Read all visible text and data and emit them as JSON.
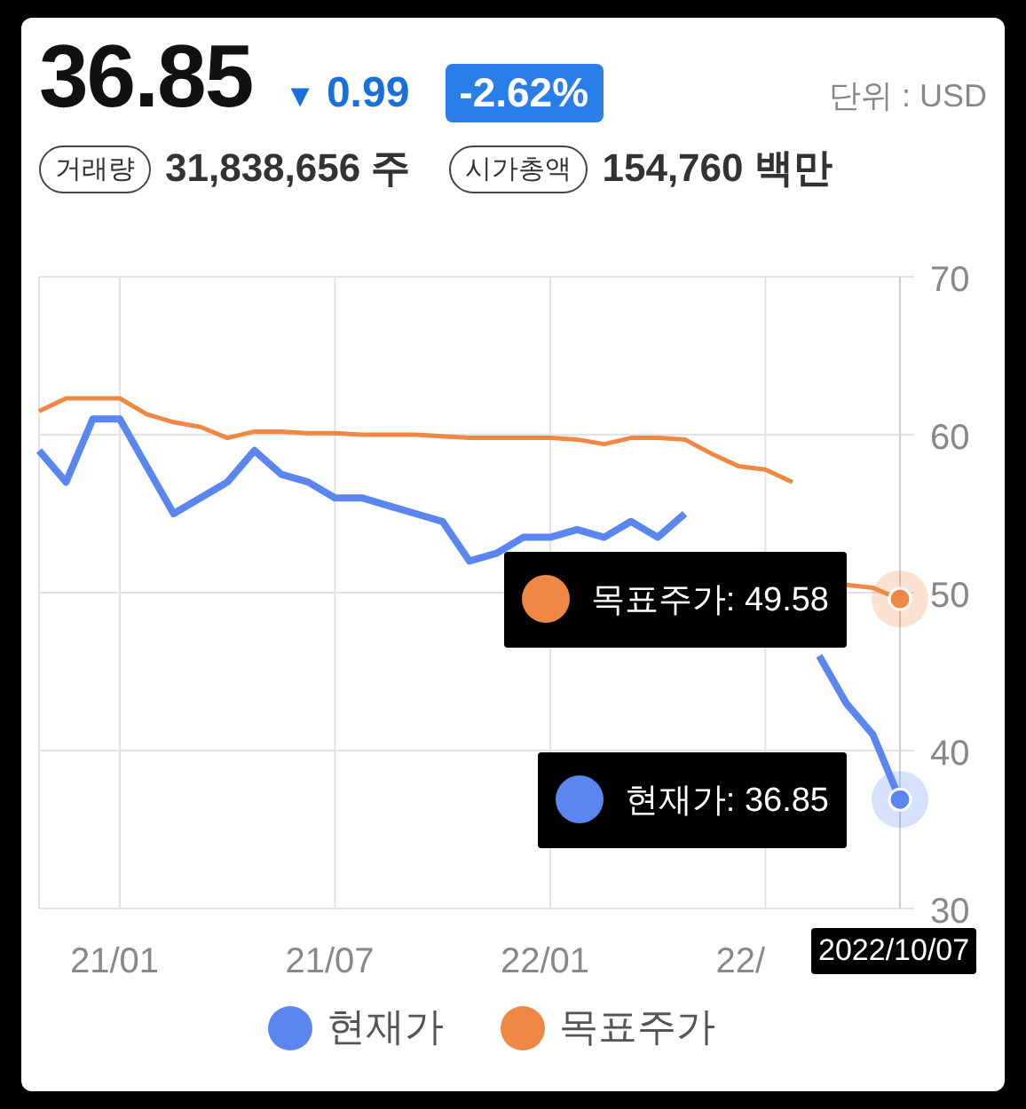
{
  "quote": {
    "price": "36.85",
    "change_arrow": "▼",
    "change": "0.99",
    "change_percent": "-2.62%",
    "unit": "단위 : USD"
  },
  "stats": [
    {
      "label": "거래량",
      "value": "31,838,656 주"
    },
    {
      "label": "시가총액",
      "value": "154,760 백만"
    }
  ],
  "chart": {
    "chart_data": {
      "type": "line",
      "categories": [
        null,
        null,
        null,
        "21/01",
        null,
        null,
        null,
        null,
        null,
        null,
        null,
        "21/07",
        null,
        null,
        null,
        null,
        null,
        null,
        null,
        "22/01",
        null,
        null,
        null,
        null,
        null,
        null,
        null,
        "22/",
        null,
        null,
        null,
        null,
        null
      ],
      "series": [
        {
          "name": "현재가",
          "color": "#5b86f0",
          "values": [
            59,
            57,
            61,
            61,
            58,
            55,
            56,
            57,
            59,
            57.5,
            57,
            56,
            56,
            55.5,
            55,
            54.5,
            52,
            52.5,
            53.5,
            53.5,
            54,
            53.5,
            54.5,
            53.5,
            55,
            null,
            null,
            null,
            null,
            46,
            43,
            41,
            36.9
          ]
        },
        {
          "name": "목표주가",
          "color": "#ee8844",
          "values": [
            61.5,
            62.3,
            62.3,
            62.3,
            61.3,
            60.8,
            60.5,
            59.8,
            60.2,
            60.2,
            60.1,
            60.1,
            60,
            60,
            60,
            59.9,
            59.8,
            59.8,
            59.8,
            59.8,
            59.7,
            59.4,
            59.8,
            59.8,
            59.7,
            58.8,
            58,
            57.8,
            57,
            null,
            50.5,
            50.3,
            49.6
          ]
        }
      ],
      "ylim": [
        30,
        70
      ],
      "grid": true,
      "yticks": [
        30,
        40,
        50,
        60,
        70
      ]
    },
    "tooltips": [
      {
        "text": "목표주가: 49.58",
        "color": "#ee8844"
      },
      {
        "text": "현재가: 36.85",
        "color": "#5b86f0"
      }
    ],
    "date_label": "2022/10/07"
  }
}
